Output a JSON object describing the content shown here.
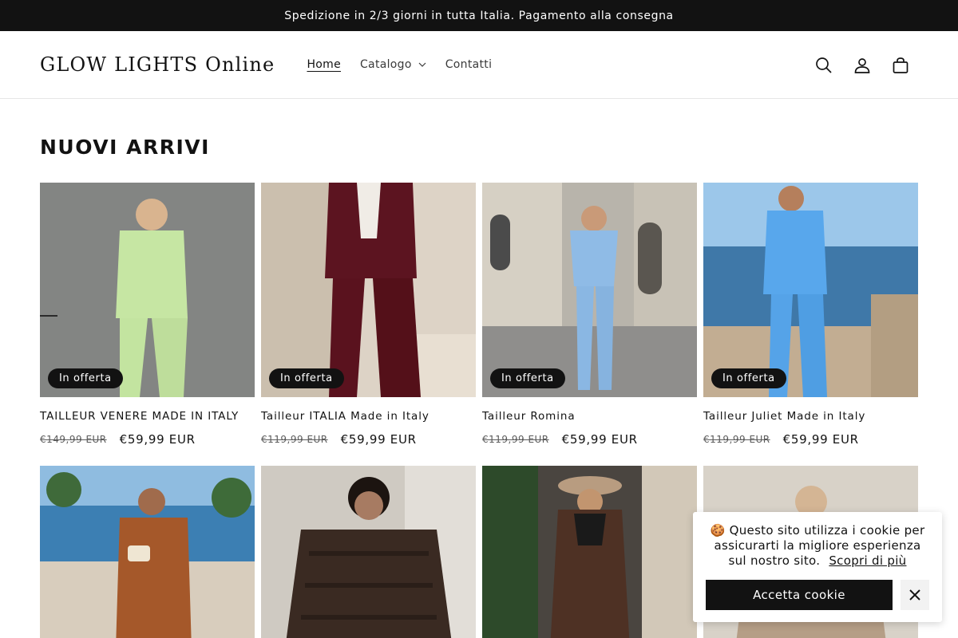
{
  "announcement": "Spedizione in 2/3 giorni in tutta Italia. Pagamento alla consegna",
  "header": {
    "logo": "GLOW LIGHTS Online",
    "nav": [
      {
        "label": "Home",
        "active": true
      },
      {
        "label": "Catalogo",
        "dropdown": true
      },
      {
        "label": "Contatti"
      }
    ],
    "icons": [
      "search-icon",
      "account-icon",
      "cart-icon"
    ]
  },
  "section": {
    "title": "NUOVI ARRIVI"
  },
  "products": [
    {
      "title": "TAILLEUR VENERE MADE IN ITALY",
      "badge": "In offerta",
      "price_old": "€149,99 EUR",
      "price_new": "€59,99 EUR",
      "image": "light green suit"
    },
    {
      "title": "Tailleur ITALIA Made in Italy",
      "badge": "In offerta",
      "price_old": "€119,99 EUR",
      "price_new": "€59,99 EUR",
      "image": "burgundy suit"
    },
    {
      "title": "Tailleur Romina",
      "badge": "In offerta",
      "price_old": "€119,99 EUR",
      "price_new": "€59,99 EUR",
      "image": "light blue suit street"
    },
    {
      "title": "Tailleur Juliet Made in Italy",
      "badge": "In offerta",
      "price_old": "€119,99 EUR",
      "price_new": "€59,99 EUR",
      "image": "blue suit seaside"
    },
    {
      "image": "brown jumpsuit seaside"
    },
    {
      "image": "dark fur coat"
    },
    {
      "image": "brown puffer coat with fur hood"
    },
    {
      "image": "beige fur coat"
    }
  ],
  "cookie": {
    "emoji": "🍪",
    "text": "Questo sito utilizza i cookie per assicurarti la migliore esperienza sul nostro sito.",
    "link": "Scopri di più",
    "accept": "Accetta cookie"
  },
  "colors": {
    "dark": "#121212",
    "border": "#e6e6e6"
  }
}
